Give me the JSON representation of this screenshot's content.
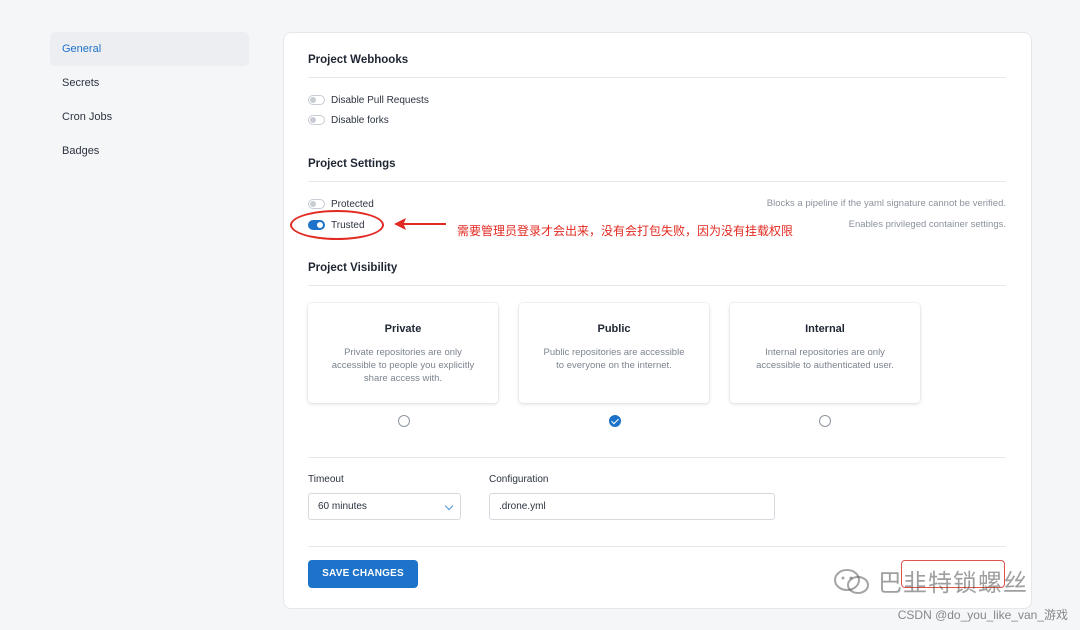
{
  "sidebar": {
    "items": [
      {
        "label": "General",
        "active": true
      },
      {
        "label": "Secrets",
        "active": false
      },
      {
        "label": "Cron Jobs",
        "active": false
      },
      {
        "label": "Badges",
        "active": false
      }
    ]
  },
  "webhooks": {
    "title": "Project Webhooks",
    "toggles": [
      {
        "label": "Disable Pull Requests",
        "on": false
      },
      {
        "label": "Disable forks",
        "on": false
      }
    ]
  },
  "settings": {
    "title": "Project Settings",
    "toggles": [
      {
        "label": "Protected",
        "on": false,
        "description": "Blocks a pipeline if the yaml signature cannot be verified."
      },
      {
        "label": "Trusted",
        "on": true,
        "description": "Enables privileged container settings."
      }
    ]
  },
  "visibility": {
    "title": "Project Visibility",
    "options": [
      {
        "title": "Private",
        "description": "Private repositories are only accessible to people you explicitly share access with.",
        "selected": false
      },
      {
        "title": "Public",
        "description": "Public repositories are accessible to everyone on the internet.",
        "selected": true
      },
      {
        "title": "Internal",
        "description": "Internal repositories are only accessible to authenticated user.",
        "selected": false
      }
    ]
  },
  "timeout": {
    "label": "Timeout",
    "value": "60 minutes"
  },
  "configuration": {
    "label": "Configuration",
    "value": ".drone.yml"
  },
  "save_label": "SAVE CHANGES",
  "annotation": {
    "text": "需要管理员登录才会出来，没有会打包失败，因为没有挂载权限"
  },
  "watermark": {
    "text": "巴韭特锁螺丝"
  },
  "credit": "CSDN @do_you_like_van_游戏",
  "colors": {
    "accent": "#1d72c9",
    "annotation": "#e22a22"
  }
}
